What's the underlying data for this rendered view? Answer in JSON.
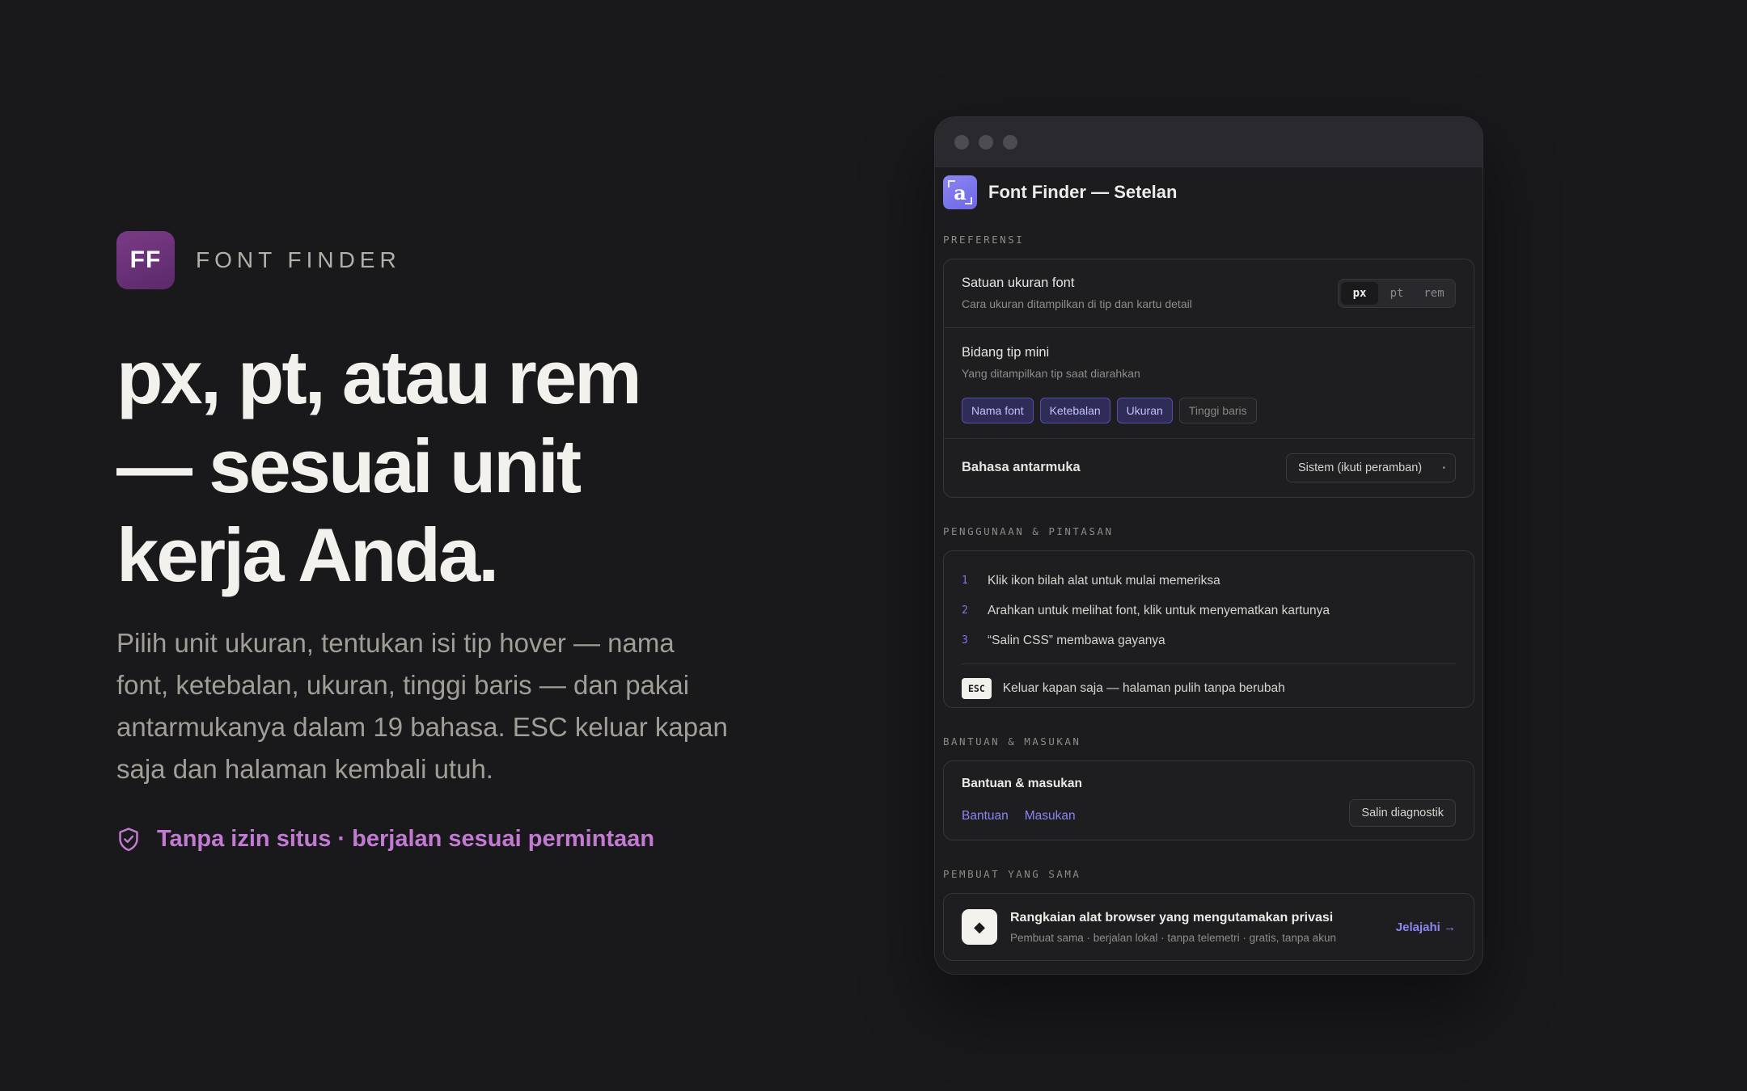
{
  "brand": {
    "logo_text": "FF",
    "name": "FONT FINDER"
  },
  "hero": {
    "headline_lines": [
      "px, pt, atau rem",
      "— sesuai unit",
      "kerja Anda."
    ],
    "lede": "Pilih unit ukuran, tentukan isi tip hover — nama font, ketebalan, ukuran, tinggi baris — dan pakai antarmukanya dalam 19 bahasa. ESC keluar kapan saja dan halaman kembali utuh.",
    "trust_text": "Tanpa izin situs · berjalan sesuai permintaan",
    "trust_icon": "shield-check-icon"
  },
  "colors": {
    "background": "#19191c",
    "brand_purple": "#6a3178",
    "accent_violet": "#8c85f2",
    "trust_pink": "#c27ad2"
  },
  "window": {
    "app_icon_letter": "a",
    "title": "Font Finder — Setelan",
    "sections": {
      "preferences": {
        "label": "PREFERENSI",
        "unit": {
          "title": "Satuan ukuran font",
          "subtitle": "Cara ukuran ditampilkan di tip dan kartu detail",
          "options": [
            "px",
            "pt",
            "rem"
          ],
          "selected": "px"
        },
        "tip_fields": {
          "title": "Bidang tip mini",
          "subtitle": "Yang ditampilkan tip saat diarahkan",
          "chips": [
            {
              "label": "Nama font",
              "active": true
            },
            {
              "label": "Ketebalan",
              "active": true
            },
            {
              "label": "Ukuran",
              "active": true
            },
            {
              "label": "Tinggi baris",
              "active": false
            }
          ]
        },
        "language": {
          "title": "Bahasa antarmuka",
          "value": "Sistem (ikuti peramban)"
        }
      },
      "usage": {
        "label": "PENGGUNAAN & PINTASAN",
        "steps": [
          {
            "num": "1",
            "text": "Klik ikon bilah alat untuk mulai memeriksa"
          },
          {
            "num": "2",
            "text": "Arahkan untuk melihat font, klik untuk menyematkan kartunya"
          },
          {
            "num": "3",
            "text": "“Salin CSS” membawa gayanya"
          }
        ],
        "esc_key": "ESC",
        "esc_text": "Keluar kapan saja — halaman pulih tanpa berubah"
      },
      "help": {
        "label": "BANTUAN & MASUKAN",
        "title": "Bantuan & masukan",
        "link_help": "Bantuan",
        "link_feedback": "Masukan",
        "button": "Salin diagnostik"
      },
      "maker": {
        "label": "PEMBUAT YANG SAMA",
        "title": "Rangkaian alat browser yang mengutamakan privasi",
        "subtitle": "Pembuat sama · berjalan lokal · tanpa telemetri · gratis, tanpa akun",
        "cta": "Jelajahi →"
      }
    }
  }
}
